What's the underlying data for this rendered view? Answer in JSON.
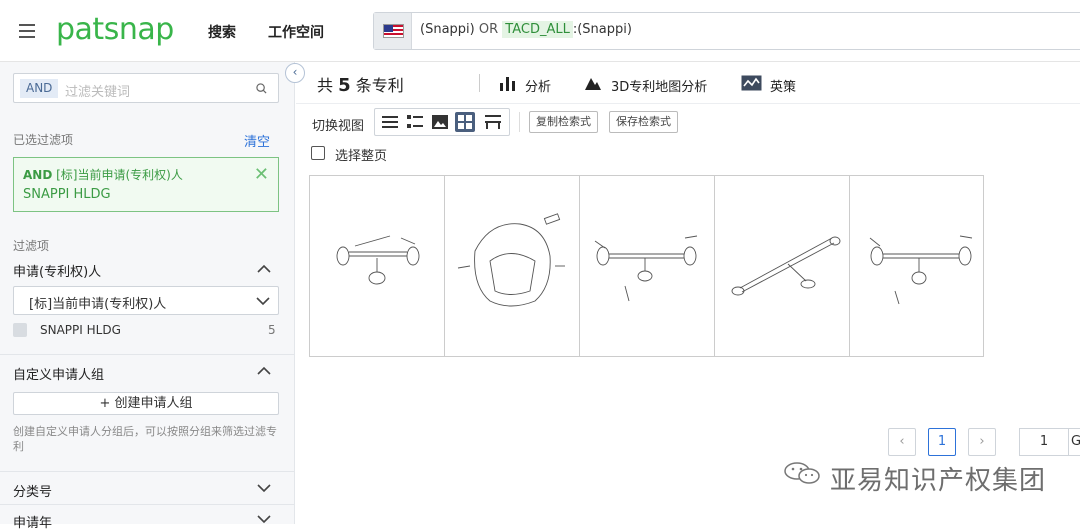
{
  "header": {
    "logo": "patsnap",
    "nav": [
      "搜索",
      "工作空间"
    ],
    "query": {
      "term1": "(Snappi)",
      "op": "OR",
      "field": "TACD_ALL",
      "term2": ":(Snappi)"
    }
  },
  "sidebar": {
    "filter_tag": "AND",
    "filter_placeholder": "过滤关键词",
    "selected_label": "已选过滤项",
    "clear": "清空",
    "selected_filter_prefix": "AND",
    "selected_filter_field": "[标]当前申请(专利权)人",
    "selected_filter_value": "SNAPPI HLDG",
    "filters_label": "过滤项",
    "applicant_section": "申请(专利权)人",
    "applicant_select": "[标]当前申请(专利权)人",
    "applicant_option": "SNAPPI HLDG",
    "applicant_option_count": "5",
    "custom_group_section": "自定义申请人组",
    "create_group_button": "+ 创建申请人组",
    "custom_group_help": "创建自定义申请人分组后，可以按照分组来筛选过滤专利",
    "classification_section": "分类号",
    "year_section": "申请年"
  },
  "main": {
    "count_prefix": "共",
    "count_value": "5",
    "count_suffix": "条专利",
    "tools": [
      "分析",
      "3D专利地图分析",
      "英策"
    ],
    "switch_view": "切换视图",
    "copy_query": "复制检索式",
    "save_query": "保存检索式",
    "select_page": "选择整页",
    "current_page": "1",
    "page_input": "1",
    "go": "G"
  },
  "watermark": "亚易知识产权集团",
  "colors": {
    "brand_green": "#39b54a",
    "link_blue": "#2d72d9",
    "active_view": "#4a5f7e"
  }
}
